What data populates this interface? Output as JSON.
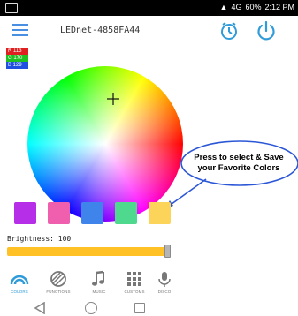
{
  "status_bar": {
    "signal_text": "4G",
    "battery": "60%",
    "time": "2:12 PM"
  },
  "header": {
    "device_name": "LEDnet-4858FA44",
    "menu_icon": "hamburger-menu-icon",
    "timer_icon": "timer-icon",
    "power_icon": "power-icon"
  },
  "rgb": {
    "r": "R 113",
    "g": "G 170",
    "b": "B 129",
    "colors": {
      "r": "#e02020",
      "g": "#20c020",
      "b": "#2050e0"
    }
  },
  "callout": {
    "text": "Press to select & Save your Favorite Colors"
  },
  "swatches": [
    "#b62ee8",
    "#ef5fae",
    "#3f84ea",
    "#4fd98f",
    "#fcd45a"
  ],
  "brightness": {
    "label": "Brightness: 100",
    "value": 100,
    "accent": "#ffc125"
  },
  "tabs": [
    {
      "label": "COLORS",
      "icon": "rainbow-icon",
      "active": true
    },
    {
      "label": "FUNCTIONS",
      "icon": "functions-icon",
      "active": false
    },
    {
      "label": "MUSIC",
      "icon": "music-note-icon",
      "active": false
    },
    {
      "label": "CUSTOMS",
      "icon": "grid-icon",
      "active": false
    },
    {
      "label": "DISCO",
      "icon": "microphone-icon",
      "active": false
    }
  ],
  "nav": {
    "back_icon": "back-triangle-icon",
    "home_icon": "home-circle-icon",
    "recents_icon": "recents-square-icon"
  }
}
